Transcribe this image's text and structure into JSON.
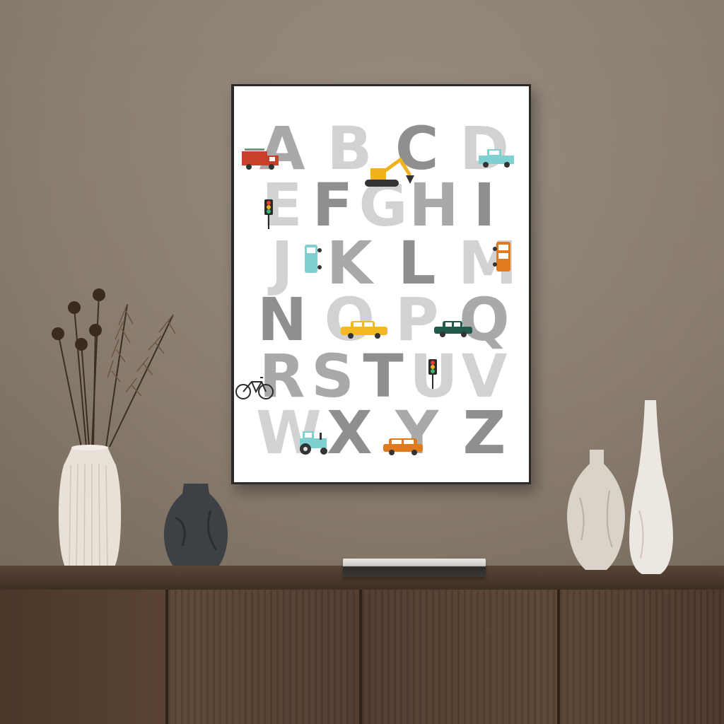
{
  "scene": {
    "description_colors": {
      "wall": "#8a7d70",
      "sideboard": "#4e3a2c",
      "poster_bg": "#ffffff",
      "letter_gray": "#8f8f8f",
      "letter_light": "#d2d2d2"
    }
  },
  "poster": {
    "letters": [
      {
        "char": "A",
        "shade": "mid"
      },
      {
        "char": "B",
        "shade": "light"
      },
      {
        "char": "C",
        "shade": "road"
      },
      {
        "char": "D",
        "shade": "light"
      },
      {
        "char": "E",
        "shade": "light"
      },
      {
        "char": "F",
        "shade": "road"
      },
      {
        "char": "G",
        "shade": "light"
      },
      {
        "char": "H",
        "shade": "mid"
      },
      {
        "char": "I",
        "shade": "road"
      },
      {
        "char": "J",
        "shade": "light"
      },
      {
        "char": "K",
        "shade": "mid"
      },
      {
        "char": "L",
        "shade": "road"
      },
      {
        "char": "M",
        "shade": "light"
      },
      {
        "char": "N",
        "shade": "road"
      },
      {
        "char": "O",
        "shade": "light"
      },
      {
        "char": "P",
        "shade": "light"
      },
      {
        "char": "Q",
        "shade": "mid"
      },
      {
        "char": "R",
        "shade": "mid"
      },
      {
        "char": "S",
        "shade": "mid"
      },
      {
        "char": "T",
        "shade": "road"
      },
      {
        "char": "U",
        "shade": "light"
      },
      {
        "char": "V",
        "shade": "light"
      },
      {
        "char": "W",
        "shade": "light"
      },
      {
        "char": "X",
        "shade": "road"
      },
      {
        "char": "Y",
        "shade": "mid"
      },
      {
        "char": "Z",
        "shade": "road"
      }
    ],
    "vehicles": [
      {
        "name": "fire-truck-icon",
        "color": "#c8402c"
      },
      {
        "name": "pickup-truck-icon",
        "color": "#7fd0d0"
      },
      {
        "name": "excavator-icon",
        "color": "#f0b21e"
      },
      {
        "name": "traffic-light-icon",
        "color": "#2a2a2a"
      },
      {
        "name": "van-icon",
        "color": "#7fd0d0"
      },
      {
        "name": "bus-icon",
        "color": "#e07a1e"
      },
      {
        "name": "taxi-icon",
        "color": "#f2b921"
      },
      {
        "name": "car-icon",
        "color": "#1f5a4c"
      },
      {
        "name": "bicycle-icon",
        "color": "#2a2a2a"
      },
      {
        "name": "tractor-icon",
        "color": "#7fd0d0"
      },
      {
        "name": "car-icon",
        "color": "#e07a1e"
      }
    ]
  }
}
